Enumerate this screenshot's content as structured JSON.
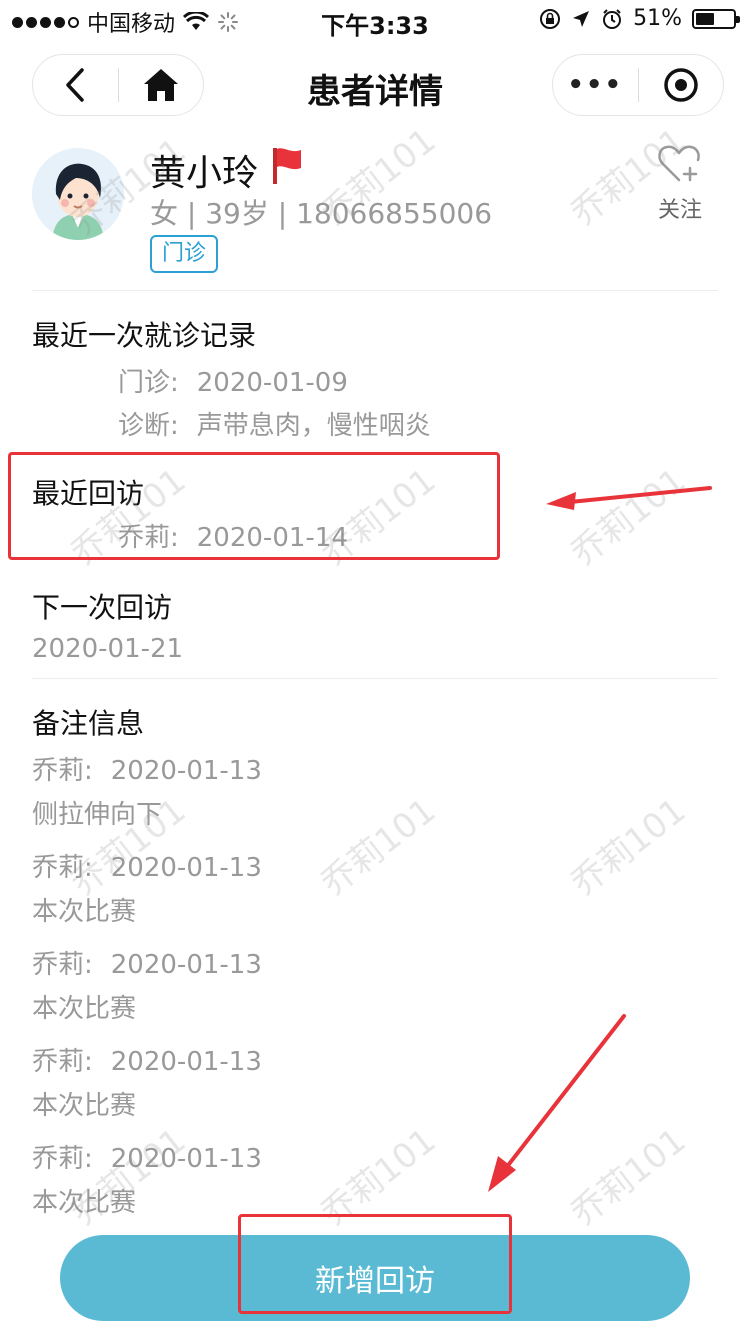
{
  "status_bar": {
    "carrier": "中国移动",
    "time": "下午3:33",
    "battery_percent": "51%",
    "battery_level": 0.51
  },
  "nav": {
    "title": "患者详情",
    "more_glyph": "•••"
  },
  "patient": {
    "name": "黄小玲",
    "meta": "女 | 39岁 | 18066855006",
    "tag": "门诊",
    "follow_label": "关注",
    "flag_color": "#e8333a"
  },
  "last_visit": {
    "title": "最近一次就诊记录",
    "type_label": "门诊:",
    "date": "2020-01-09",
    "diagnosis_label": "诊断:",
    "diagnosis": "声带息肉，慢性咽炎"
  },
  "recent_followup": {
    "title": "最近回访",
    "doctor_label": "乔莉:",
    "date": "2020-01-14"
  },
  "next_followup": {
    "title": "下一次回访",
    "date": "2020-01-21"
  },
  "notes": {
    "title": "备注信息",
    "items": [
      {
        "author": "乔莉:",
        "date": "2020-01-13",
        "text": "侧拉伸向下"
      },
      {
        "author": "乔莉:",
        "date": "2020-01-13",
        "text": "本次比赛"
      },
      {
        "author": "乔莉:",
        "date": "2020-01-13",
        "text": "本次比赛"
      },
      {
        "author": "乔莉:",
        "date": "2020-01-13",
        "text": "本次比赛"
      },
      {
        "author": "乔莉:",
        "date": "2020-01-13",
        "text": "本次比赛"
      }
    ]
  },
  "watermark_text": "乔莉101",
  "primary_button": {
    "label": "新增回访",
    "color": "#5bbad3"
  },
  "annotation_color": "#e8333a"
}
